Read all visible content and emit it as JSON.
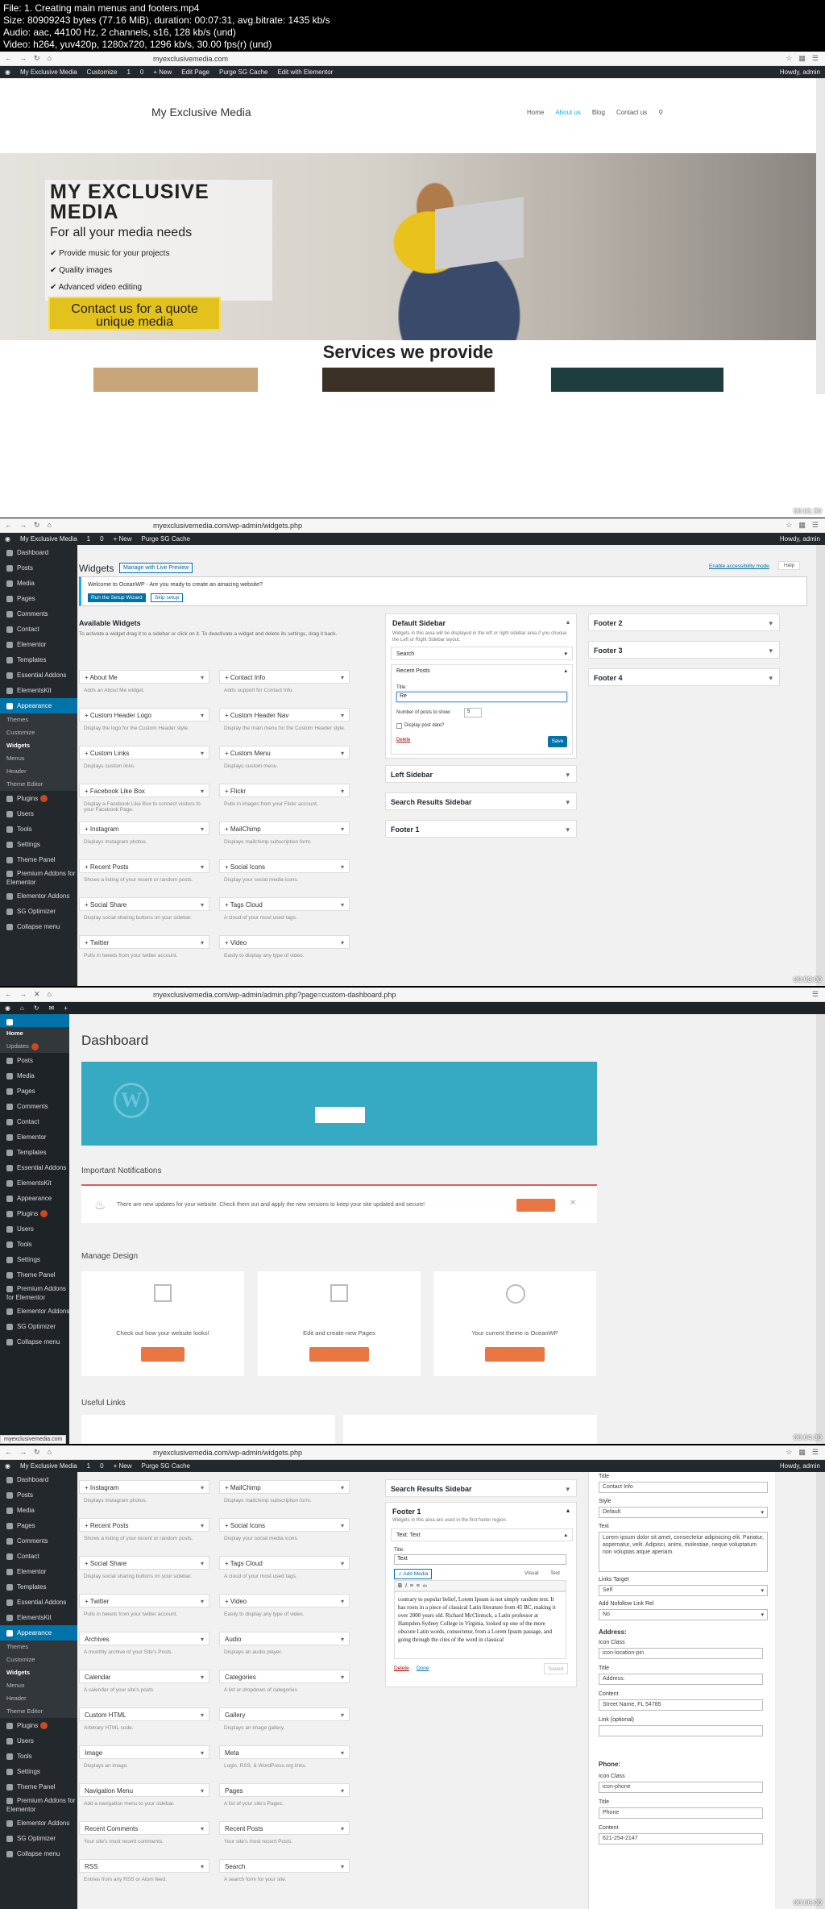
{
  "header": {
    "lines": [
      "File: 1. Creating main menus and footers.mp4",
      "Size: 80909243 bytes (77.16 MiB), duration: 00:07:31, avg.bitrate: 1435 kb/s",
      "Audio: aac, 44100 Hz, 2 channels, s16, 128 kb/s (und)",
      "Video: h264, yuv420p, 1280x720, 1296 kb/s, 30.00 fps(r) (und)"
    ]
  },
  "frame1": {
    "url": "myexclusivemedia.com",
    "adminbar": [
      "My Exclusive Media",
      "Customize",
      "1",
      "0",
      "+ New",
      "Edit Page",
      "Purge SG Cache",
      "Edit with Elementor"
    ],
    "howdy": "Howdy, admin",
    "site_title": "My Exclusive Media",
    "menu": [
      "Home",
      "About us",
      "Blog",
      "Contact us"
    ],
    "hero_title": "MY EXCLUSIVE MEDIA",
    "hero_sub": "For all your media needs",
    "hero_bullets": [
      "Provide music for your projects",
      "Quality images",
      "Advanced video editing"
    ],
    "hero_cta": "Contact us for a quote unique media",
    "services_title": "Services we provide",
    "time": "00:01:30"
  },
  "frame2": {
    "url": "myexclusivemedia.com/wp-admin/widgets.php",
    "adminbar": [
      "My Exclusive Media",
      "1",
      "0",
      "+ New",
      "Purge SG Cache"
    ],
    "howdy": "Howdy, admin",
    "help": "Help",
    "a11y": "Enable accessibility mode",
    "sidebar": [
      "Dashboard",
      "Posts",
      "Media",
      "Pages",
      "Comments",
      "Contact",
      "Elementor",
      "Templates",
      "Essential Addons",
      "ElementsKit",
      "Appearance",
      "Plugins",
      "Users",
      "Tools",
      "Settings",
      "Theme Panel",
      "Premium Addons for Elementor",
      "Elementor Addons",
      "SG Optimizer",
      "Collapse menu"
    ],
    "submenu": [
      "Themes",
      "Customize",
      "Widgets",
      "Menus",
      "Header",
      "Theme Editor"
    ],
    "title": "Widgets",
    "manage": "Manage with Live Preview",
    "notice": "Welcome to OceanWP - Are you ready to create an amazing website?",
    "notice_btn1": "Run the Setup Wizard",
    "notice_btn2": "Skip setup",
    "avail_title": "Available Widgets",
    "avail_desc": "To activate a widget drag it to a sidebar or click on it. To deactivate a widget and delete its settings, drag it back.",
    "widgets": [
      {
        "name": "+ About Me",
        "desc": "Adds an About Me widget."
      },
      {
        "name": "+ Contact Info",
        "desc": "Adds support for Contact Info."
      },
      {
        "name": "+ Custom Header Logo",
        "desc": "Display the logo for the Custom Header style."
      },
      {
        "name": "+ Custom Header Nav",
        "desc": "Display the main menu for the Custom Header style."
      },
      {
        "name": "+ Custom Links",
        "desc": "Displays custom links."
      },
      {
        "name": "+ Custom Menu",
        "desc": "Displays custom menu."
      },
      {
        "name": "+ Facebook Like Box",
        "desc": "Display a Facebook Like Box to connect visitors to your Facebook Page."
      },
      {
        "name": "+ Flickr",
        "desc": "Pulls in images from your Flickr account."
      },
      {
        "name": "+ Instagram",
        "desc": "Displays Instagram photos."
      },
      {
        "name": "+ MailChimp",
        "desc": "Displays mailchimp subscription form."
      },
      {
        "name": "+ Recent Posts",
        "desc": "Shows a listing of your recent or random posts."
      },
      {
        "name": "+ Social Icons",
        "desc": "Display your social media icons."
      },
      {
        "name": "+ Social Share",
        "desc": "Display social sharing buttons on your sidebar."
      },
      {
        "name": "+ Tags Cloud",
        "desc": "A cloud of your most used tags."
      },
      {
        "name": "+ Twitter",
        "desc": "Pulls in tweets from your twitter account."
      },
      {
        "name": "+ Video",
        "desc": "Easily to display any type of video."
      }
    ],
    "default_sidebar": "Default Sidebar",
    "default_desc": "Widgets in this area will be displayed in the left or right sidebar area if you choose the Left or Right Sidebar layout.",
    "search": "Search",
    "recent_posts": "Recent Posts",
    "title_label": "Title:",
    "title_value": "Re",
    "num_label": "Number of posts to show:",
    "num_value": "5",
    "date_label": "Display post date?",
    "delete": "Delete",
    "save": "Save",
    "other_sidebars": [
      "Left Sidebar",
      "Search Results Sidebar",
      "Footer 1"
    ],
    "footers": [
      "Footer 2",
      "Footer 3",
      "Footer 4"
    ],
    "time": "00:03:00"
  },
  "frame3": {
    "url": "myexclusivemedia.com/wp-admin/admin.php?page=custom-dashboard.php",
    "sidebar": [
      "Home",
      "Updates",
      "Posts",
      "Media",
      "Pages",
      "Comments",
      "Contact",
      "Elementor",
      "Templates",
      "Essential Addons",
      "ElementsKit",
      "Appearance",
      "Plugins",
      "Users",
      "Tools",
      "Settings",
      "Theme Panel",
      "Premium Addons for Elementor",
      "Elementor Addons",
      "SG Optimizer",
      "Collapse menu"
    ],
    "title": "Dashboard",
    "notif_title": "Important Notifications",
    "notif_text": "There are new updates for your website. Check them out and apply the new versions to keep your site updated and secure!",
    "manage_title": "Manage Design",
    "cards": [
      "Check out how your website looks!",
      "Edit and create new Pages",
      "Your current theme is OceanWP"
    ],
    "useful": "Useful Links",
    "status": "myexclusivemedia.com",
    "time": "00:04:30"
  },
  "frame4": {
    "url": "myexclusivemedia.com/wp-admin/widgets.php",
    "adminbar": [
      "My Exclusive Media",
      "1",
      "0",
      "+ New",
      "Purge SG Cache"
    ],
    "howdy": "Howdy, admin",
    "widgets": [
      {
        "name": "+ Instagram",
        "desc": "Displays Instagram photos."
      },
      {
        "name": "+ MailChimp",
        "desc": "Displays mailchimp subscription form."
      },
      {
        "name": "+ Recent Posts",
        "desc": "Shows a listing of your recent or random posts."
      },
      {
        "name": "+ Social Icons",
        "desc": "Display your social media icons."
      },
      {
        "name": "+ Social Share",
        "desc": "Display social sharing buttons on your sidebar."
      },
      {
        "name": "+ Tags Cloud",
        "desc": "A cloud of your most used tags."
      },
      {
        "name": "+ Twitter",
        "desc": "Pulls in tweets from your twitter account."
      },
      {
        "name": "+ Video",
        "desc": "Easily to display any type of video."
      },
      {
        "name": "Archives",
        "desc": "A monthly archive of your Site's Posts."
      },
      {
        "name": "Audio",
        "desc": "Displays an audio player."
      },
      {
        "name": "Calendar",
        "desc": "A calendar of your site's posts."
      },
      {
        "name": "Categories",
        "desc": "A list or dropdown of categories."
      },
      {
        "name": "Custom HTML",
        "desc": "Arbitrary HTML code."
      },
      {
        "name": "Gallery",
        "desc": "Displays an image gallery."
      },
      {
        "name": "Image",
        "desc": "Displays an image."
      },
      {
        "name": "Meta",
        "desc": "Login, RSS, & WordPress.org links."
      },
      {
        "name": "Navigation Menu",
        "desc": "Add a navigation menu to your sidebar."
      },
      {
        "name": "Pages",
        "desc": "A list of your site's Pages."
      },
      {
        "name": "Recent Comments",
        "desc": "Your site's most recent comments."
      },
      {
        "name": "Recent Posts",
        "desc": "Your site's most recent Posts."
      },
      {
        "name": "RSS",
        "desc": "Entries from any RSS or Atom feed."
      },
      {
        "name": "Search",
        "desc": "A search form for your site."
      }
    ],
    "search_results": "Search Results Sidebar",
    "footer1": "Footer 1",
    "footer1_desc": "Widgets in this area are used in the first footer region.",
    "text_widget": "Text: Text",
    "title_label": "Title:",
    "title_value": "Text",
    "add_media": "Add Media",
    "visual": "Visual",
    "text_tab": "Text",
    "body": "contrary to popular belief, Lorem Ipsum is not simply random text. It has roots in a piece of classical Latin literature from 45 BC, making it over 2000 years old. Richard McClintock, a Latin professor at Hampden-Sydney College in Virginia, looked up one of the more obscure Latin words, consectetur, from a Lorem Ipsum passage, and going through the cites of the word in classical",
    "delete": "Delete",
    "done": "Done",
    "saved": "Saved",
    "right": {
      "title_label": "Title",
      "title_value": "Contact Info",
      "style_label": "Style",
      "style_value": "Default",
      "text_label": "Text",
      "text_value": "Lorem ipsum dolor sit amet, consectetur adipisicing elit. Pariatur, aspernatur, velit. Adipisci, animi, molestiae, neque voluptatum non voluptas atque aperiam.",
      "target_label": "Links Target",
      "target_value": "Self",
      "nofollow_label": "Add Nofollow Link Rel",
      "nofollow_value": "No",
      "address_head": "Address:",
      "icon_class": "Icon Class",
      "addr_icon": "icon-location-pin",
      "addr_title_label": "Title",
      "addr_title": "Address:",
      "content_label": "Content",
      "addr_content": "Street Name, FL 54785",
      "link_label": "Link (optional)",
      "phone_head": "Phone:",
      "phone_icon": "icon-phone",
      "phone_title": "Phone",
      "phone_content": "621-254-2147"
    },
    "time": "00:06:00"
  }
}
